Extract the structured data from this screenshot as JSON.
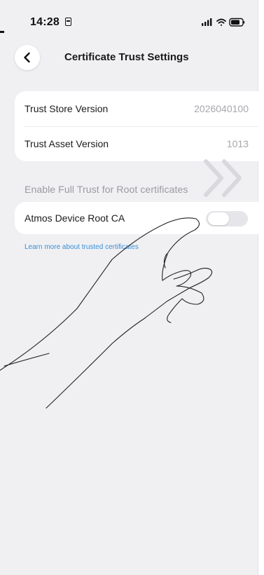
{
  "status_bar": {
    "time": "14:28",
    "icons": [
      "calendar-badge-icon",
      "signal-icon",
      "wifi-icon",
      "battery-icon"
    ]
  },
  "nav": {
    "back_icon": "chevron-left-icon",
    "title": "Certificate Trust Settings"
  },
  "info": {
    "rows": [
      {
        "label": "Trust Store Version",
        "value": "2026040100"
      },
      {
        "label": "Trust Asset Version",
        "value": "1013"
      }
    ]
  },
  "section": {
    "header": "Enable Full Trust for Root certificates"
  },
  "toggle_row": {
    "label": "Atmos Device Root CA",
    "enabled": false
  },
  "learn_more": {
    "text": "Learn more about trusted certificates"
  },
  "colors": {
    "background": "#f0f0f3",
    "card": "#ffffff",
    "value_text": "#a7a7ad",
    "section_text": "#9a9aa0",
    "link": "#3a8fd6",
    "toggle_off": "#e5e5ea"
  },
  "overlay_icons": [
    "swipe-hand-icon",
    "double-chevron-right-icon"
  ]
}
